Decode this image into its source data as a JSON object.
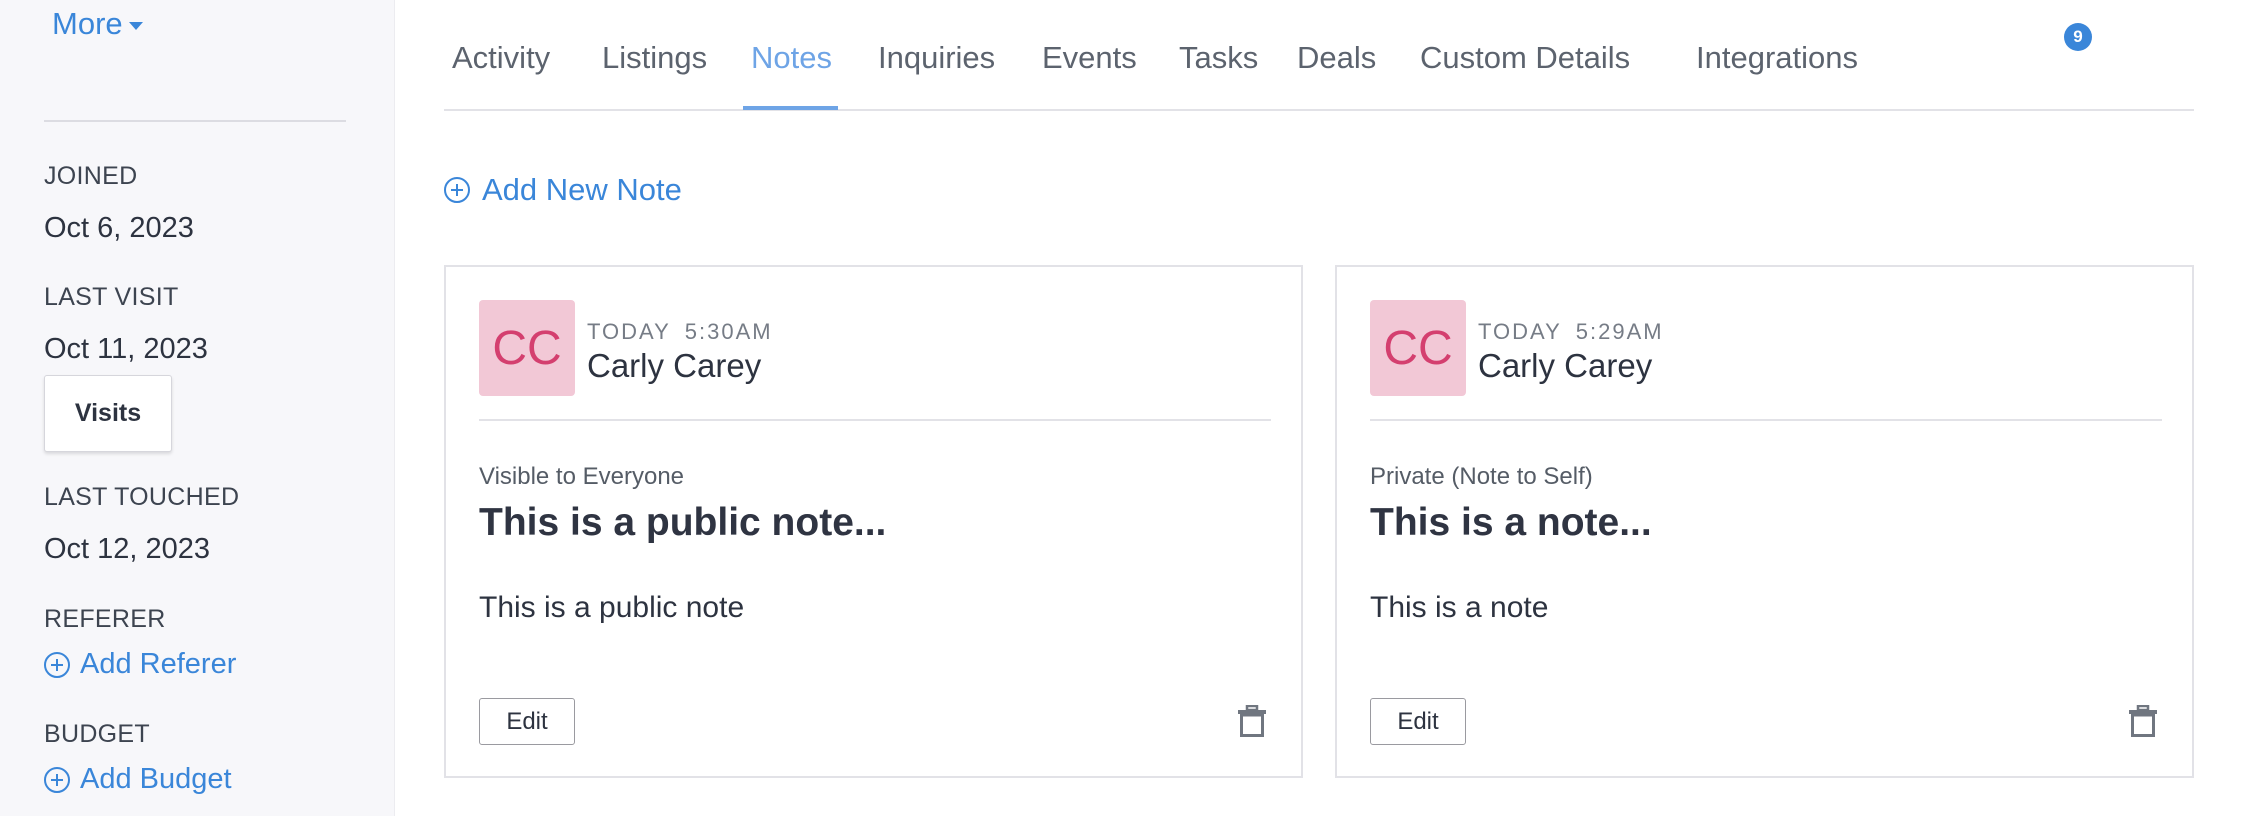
{
  "sidebar": {
    "more_label": "More",
    "joined": {
      "label": "JOINED",
      "value": "Oct 6, 2023"
    },
    "last_visit": {
      "label": "LAST VISIT",
      "value": "Oct 11, 2023"
    },
    "visits_button": "Visits",
    "last_touched": {
      "label": "LAST TOUCHED",
      "value": "Oct 12, 2023"
    },
    "referer": {
      "label": "REFERER",
      "add_label": "Add Referer"
    },
    "budget": {
      "label": "BUDGET",
      "add_label": "Add Budget"
    }
  },
  "tabs": [
    {
      "label": "Activity"
    },
    {
      "label": "Listings"
    },
    {
      "label": "Notes",
      "active": true
    },
    {
      "label": "Inquiries"
    },
    {
      "label": "Events"
    },
    {
      "label": "Tasks"
    },
    {
      "label": "Deals"
    },
    {
      "label": "Custom Details",
      "badge": "9"
    },
    {
      "label": "Integrations"
    }
  ],
  "add_note_label": "Add New Note",
  "notes": [
    {
      "initials": "CC",
      "day": "TODAY",
      "time": "5:30AM",
      "author": "Carly Carey",
      "visibility": "Visible to Everyone",
      "title": "This is a public note...",
      "body": "This is a public note",
      "edit_label": "Edit"
    },
    {
      "initials": "CC",
      "day": "TODAY",
      "time": "5:29AM",
      "author": "Carly Carey",
      "visibility": "Private (Note to Self)",
      "title": "This is a note...",
      "body": "This is a note",
      "edit_label": "Edit"
    }
  ],
  "colors": {
    "accent": "#3a86d9",
    "active_tab": "#6ea4e6",
    "avatar_bg": "#f2c8d6",
    "avatar_text": "#d43f6f"
  },
  "icons": [
    "chevron-down-icon",
    "plus-circle-icon",
    "trash-icon"
  ]
}
